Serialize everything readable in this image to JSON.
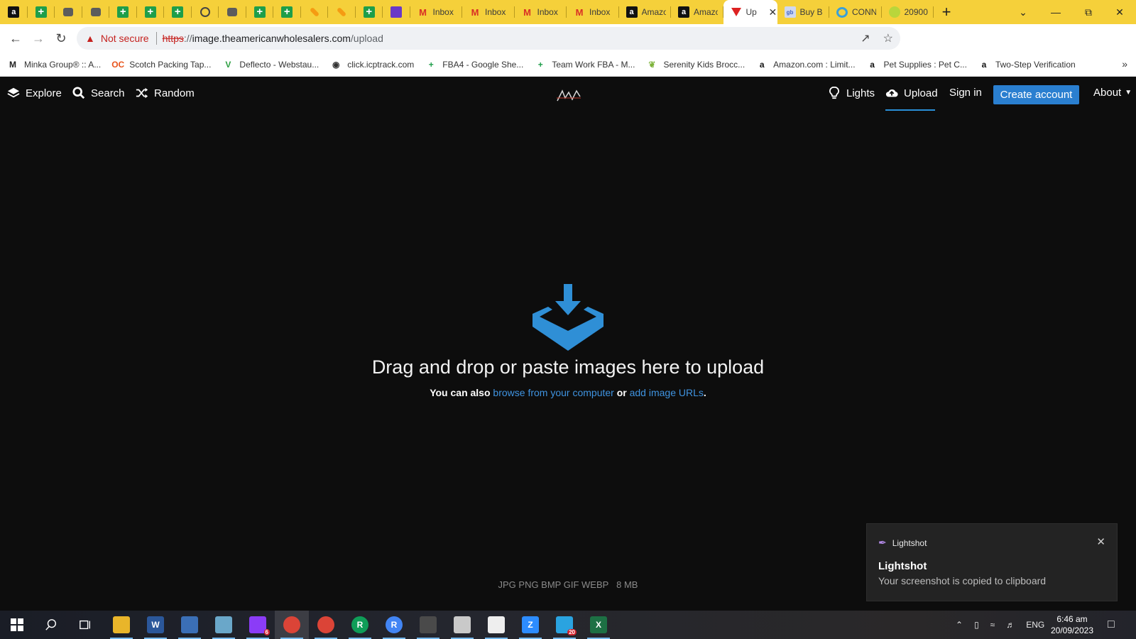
{
  "browser": {
    "tabs": [
      {
        "kind": "amz",
        "title": ""
      },
      {
        "kind": "sheet",
        "title": ""
      },
      {
        "kind": "folder",
        "title": ""
      },
      {
        "kind": "folder",
        "title": ""
      },
      {
        "kind": "sheet",
        "title": ""
      },
      {
        "kind": "sheet",
        "title": ""
      },
      {
        "kind": "sheet",
        "title": ""
      },
      {
        "kind": "globe",
        "title": ""
      },
      {
        "kind": "folder",
        "title": ""
      },
      {
        "kind": "sheet",
        "title": ""
      },
      {
        "kind": "sheet",
        "title": ""
      },
      {
        "kind": "pen",
        "title": ""
      },
      {
        "kind": "pen",
        "title": ""
      },
      {
        "kind": "sheet",
        "title": ""
      },
      {
        "kind": "list",
        "title": ""
      },
      {
        "kind": "gmail",
        "title": "Inbox"
      },
      {
        "kind": "gmail",
        "title": "Inbox"
      },
      {
        "kind": "gmail",
        "title": "Inbox"
      },
      {
        "kind": "gmail",
        "title": "Inbox"
      },
      {
        "kind": "amz",
        "title": "Amazo"
      },
      {
        "kind": "amz",
        "title": "Amazo"
      },
      {
        "kind": "imgred",
        "title": "Up",
        "active": true
      },
      {
        "kind": "gb",
        "title": "Buy B"
      },
      {
        "kind": "conn",
        "title": "CONN"
      },
      {
        "kind": "ball",
        "title": "20900"
      }
    ],
    "new_tab": "+",
    "address": {
      "warning": "Not secure",
      "scheme": "https",
      "host_sep": "://",
      "host": "image.theamericanwholesalers.com",
      "path": "/upload"
    },
    "bookmarks": [
      {
        "icon": "M",
        "label": "Minka Group® :: A...",
        "color": "#222222"
      },
      {
        "icon": "OC",
        "label": "Scotch Packing Tap...",
        "color": "#e8541c"
      },
      {
        "icon": "V",
        "label": "Deflecto - Webstau...",
        "color": "#2ea043"
      },
      {
        "icon": "◉",
        "label": "click.icptrack.com",
        "color": "#333333"
      },
      {
        "icon": "+",
        "label": "FBA4 - Google She...",
        "color": "#1e9e4a"
      },
      {
        "icon": "+",
        "label": "Team Work FBA - M...",
        "color": "#1e9e4a"
      },
      {
        "icon": "❦",
        "label": "Serenity Kids Brocc...",
        "color": "#7db33b"
      },
      {
        "icon": "a",
        "label": "Amazon.com : Limit...",
        "color": "#111111"
      },
      {
        "icon": "a",
        "label": "Pet Supplies : Pet C...",
        "color": "#111111"
      },
      {
        "icon": "a",
        "label": "Two-Step Verification",
        "color": "#111111"
      }
    ],
    "bookmarks_more": "»"
  },
  "site": {
    "nav": {
      "explore": "Explore",
      "search": "Search",
      "random": "Random",
      "lights": "Lights",
      "upload": "Upload",
      "signin": "Sign in",
      "create_account": "Create account",
      "about": "About"
    },
    "headline": "Drag and drop or paste images here to upload",
    "sub_prefix": "You can also ",
    "sub_browse": "browse from your computer",
    "sub_or": " or ",
    "sub_urls": "add image URLs",
    "sub_suffix": ".",
    "formats": "JPG PNG BMP GIF WEBP",
    "max_size": "8 MB",
    "accent_color": "#2a8fd8"
  },
  "toast": {
    "app": "Lightshot",
    "title": "Lightshot",
    "message": "Your screenshot is copied to clipboard"
  },
  "taskbar": {
    "apps": [
      {
        "name": "file-explorer",
        "label": "",
        "color": "#e9b52a"
      },
      {
        "name": "word",
        "label": "W",
        "color": "#2b579a"
      },
      {
        "name": "app-blue",
        "label": "",
        "color": "#3b6fb6"
      },
      {
        "name": "app-notepad",
        "label": "",
        "color": "#6aa7c9"
      },
      {
        "name": "messenger",
        "label": "",
        "color": "#8b3cf7",
        "badge": "6"
      },
      {
        "name": "chrome",
        "label": "",
        "color": "#db4437",
        "active": true
      },
      {
        "name": "chrome",
        "label": "",
        "color": "#db4437"
      },
      {
        "name": "chrome",
        "label": "R",
        "color": "#0f9d58"
      },
      {
        "name": "chrome",
        "label": "R",
        "color": "#4285f4"
      },
      {
        "name": "calculator",
        "label": "",
        "color": "#4a4a4a"
      },
      {
        "name": "app-photo",
        "label": "",
        "color": "#c9c9c9"
      },
      {
        "name": "app-chart",
        "label": "",
        "color": "#eeeeee"
      },
      {
        "name": "zoom",
        "label": "Z",
        "color": "#2d8cff"
      },
      {
        "name": "telegram",
        "label": "",
        "color": "#2aa3e0",
        "badge": "20"
      },
      {
        "name": "excel",
        "label": "X",
        "color": "#1d7044"
      }
    ],
    "language": "ENG",
    "time": "6:46 am",
    "date": "20/09/2023"
  }
}
